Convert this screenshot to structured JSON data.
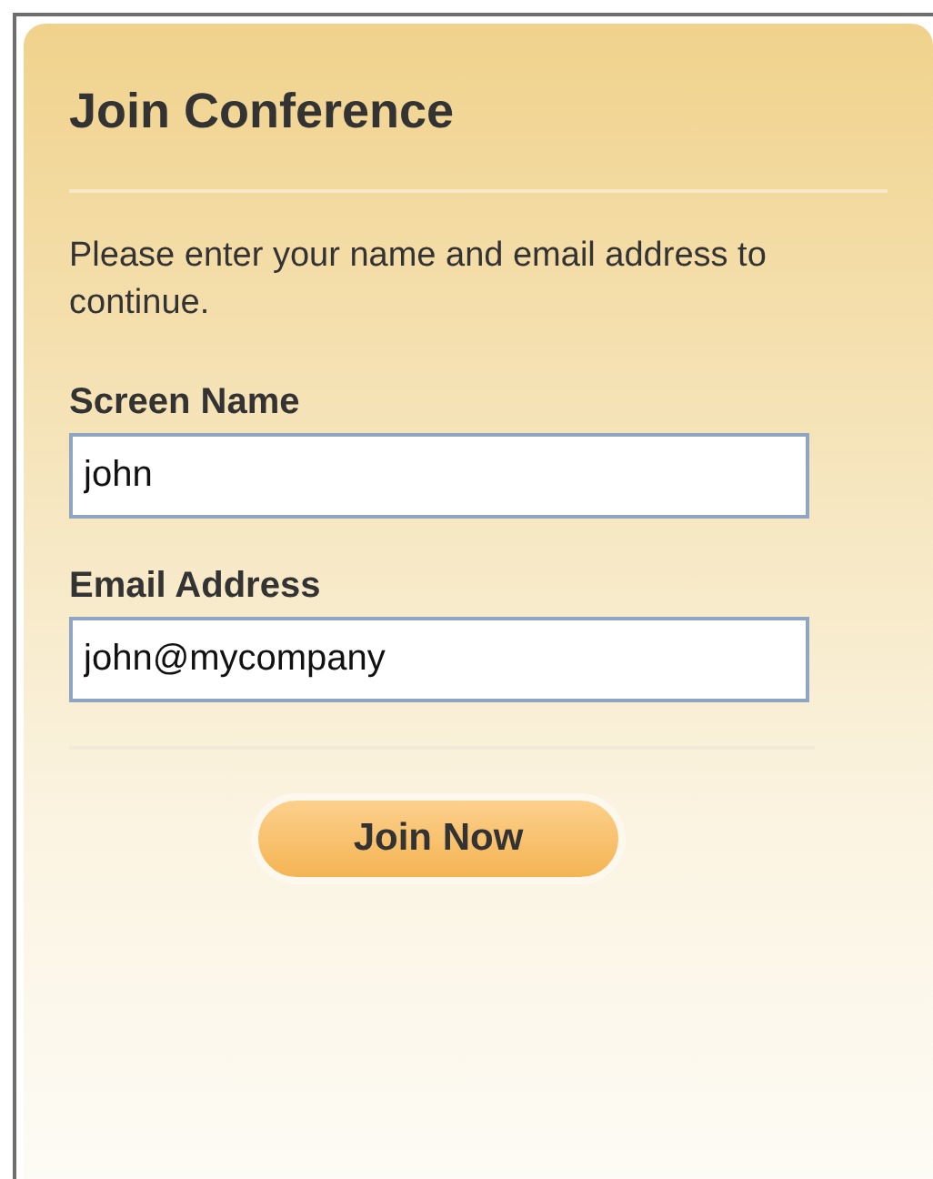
{
  "title": "Join Conference",
  "instructions": "Please enter your name and email address to continue.",
  "fields": [
    {
      "label": "Screen Name",
      "value": "john"
    },
    {
      "label": "Email Address",
      "value": "john@mycompany"
    }
  ],
  "button": "Join Now"
}
